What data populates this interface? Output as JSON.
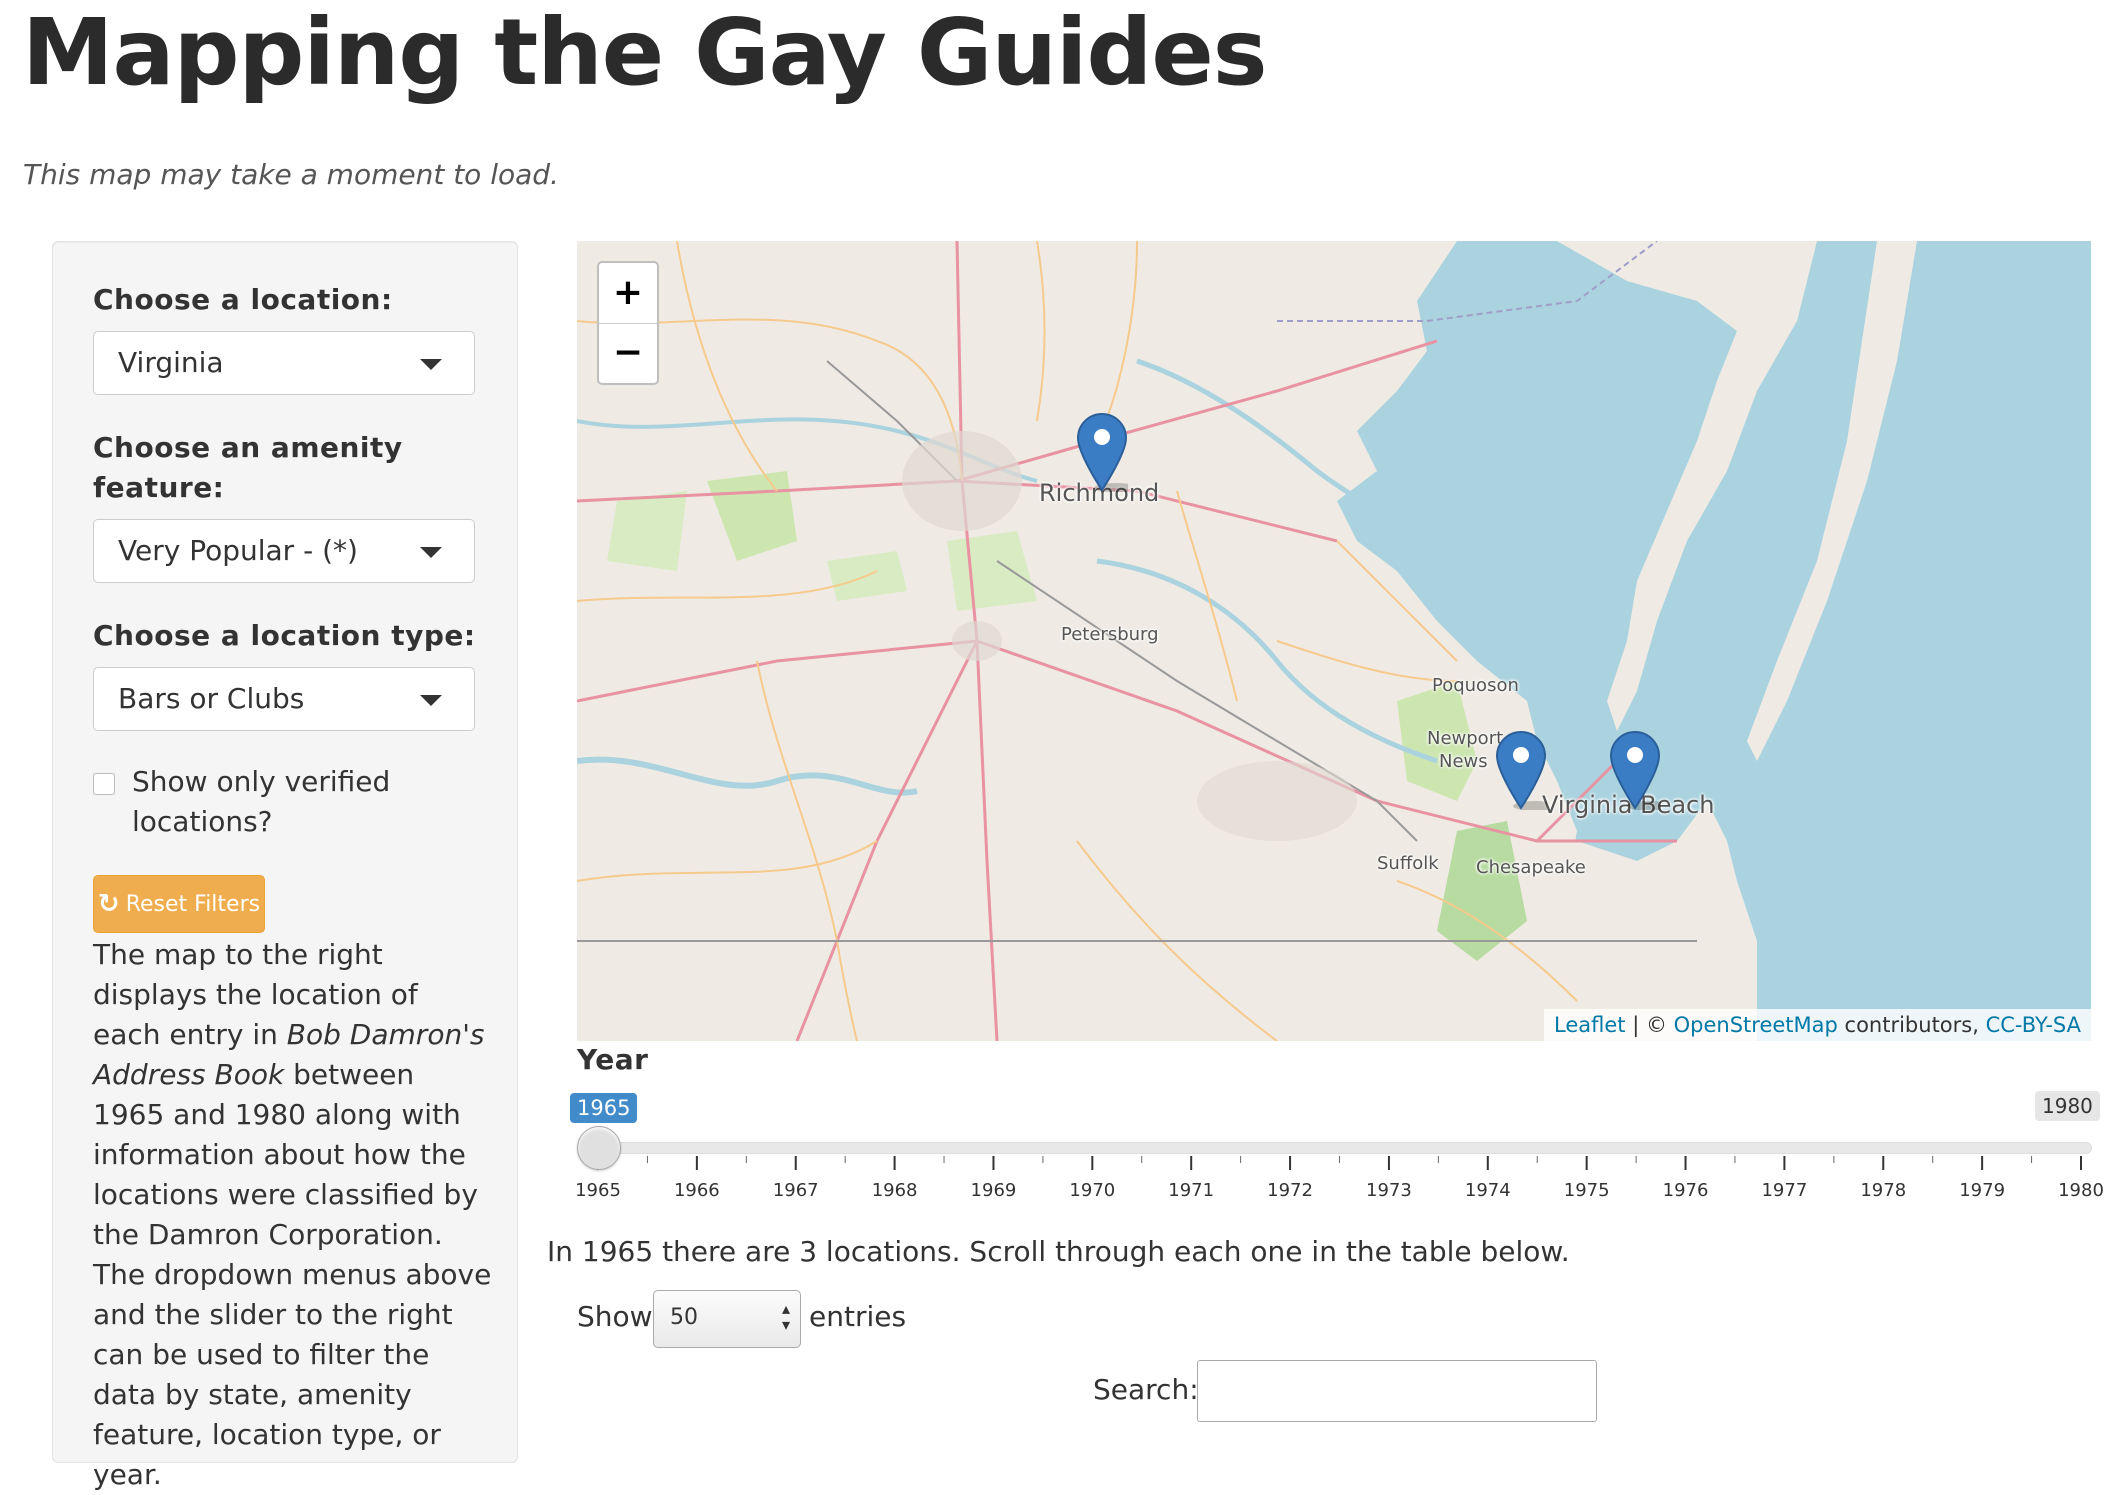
{
  "header": {
    "title": "Mapping the Gay Guides",
    "subtitle": "This map may take a moment to load."
  },
  "sidebar": {
    "location_label": "Choose a location:",
    "location_value": "Virginia",
    "amenity_label": "Choose an amenity feature:",
    "amenity_value": "Very Popular - (*)",
    "type_label": "Choose a location type:",
    "type_value": "Bars or Clubs",
    "verified_label": "Show only verified locations?",
    "reset_label": "Reset Filters",
    "reset_icon": "refresh-icon",
    "description_pre": "The map to the right displays the location of each entry in ",
    "description_book": "Bob Damron's Address Book",
    "description_post": " between 1965 and 1980 along with information about how the locations were classified by the Damron Corporation. The dropdown menus above and the slider to the right can be used to filter the data by state, amenity feature, location type, or year."
  },
  "map": {
    "zoom_in": "+",
    "zoom_out": "−",
    "cities": [
      "Richmond",
      "Petersburg",
      "Poquoson",
      "Newport",
      "News",
      "Virginia Beach",
      "Suffolk",
      "Chesapeake"
    ],
    "markers": [
      "Richmond",
      "Newport News",
      "Virginia Beach"
    ],
    "marker_color": "#3b7dc4",
    "attribution": {
      "leaflet": "Leaflet",
      "sep": " | © ",
      "osm": "OpenStreetMap",
      "contrib": " contributors, ",
      "license": "CC-BY-SA"
    }
  },
  "slider": {
    "label": "Year",
    "min_tag": "1965",
    "max_tag": "1980",
    "value": 1965,
    "ticks": [
      "1965",
      "1966",
      "1967",
      "1968",
      "1969",
      "1970",
      "1971",
      "1972",
      "1973",
      "1974",
      "1975",
      "1976",
      "1977",
      "1978",
      "1979",
      "1980"
    ]
  },
  "results": {
    "info": "In 1965 there are 3 locations. Scroll through each one in the table below.",
    "show_label": "Show",
    "show_value": "50",
    "entries_label": "entries",
    "search_label": "Search:"
  }
}
